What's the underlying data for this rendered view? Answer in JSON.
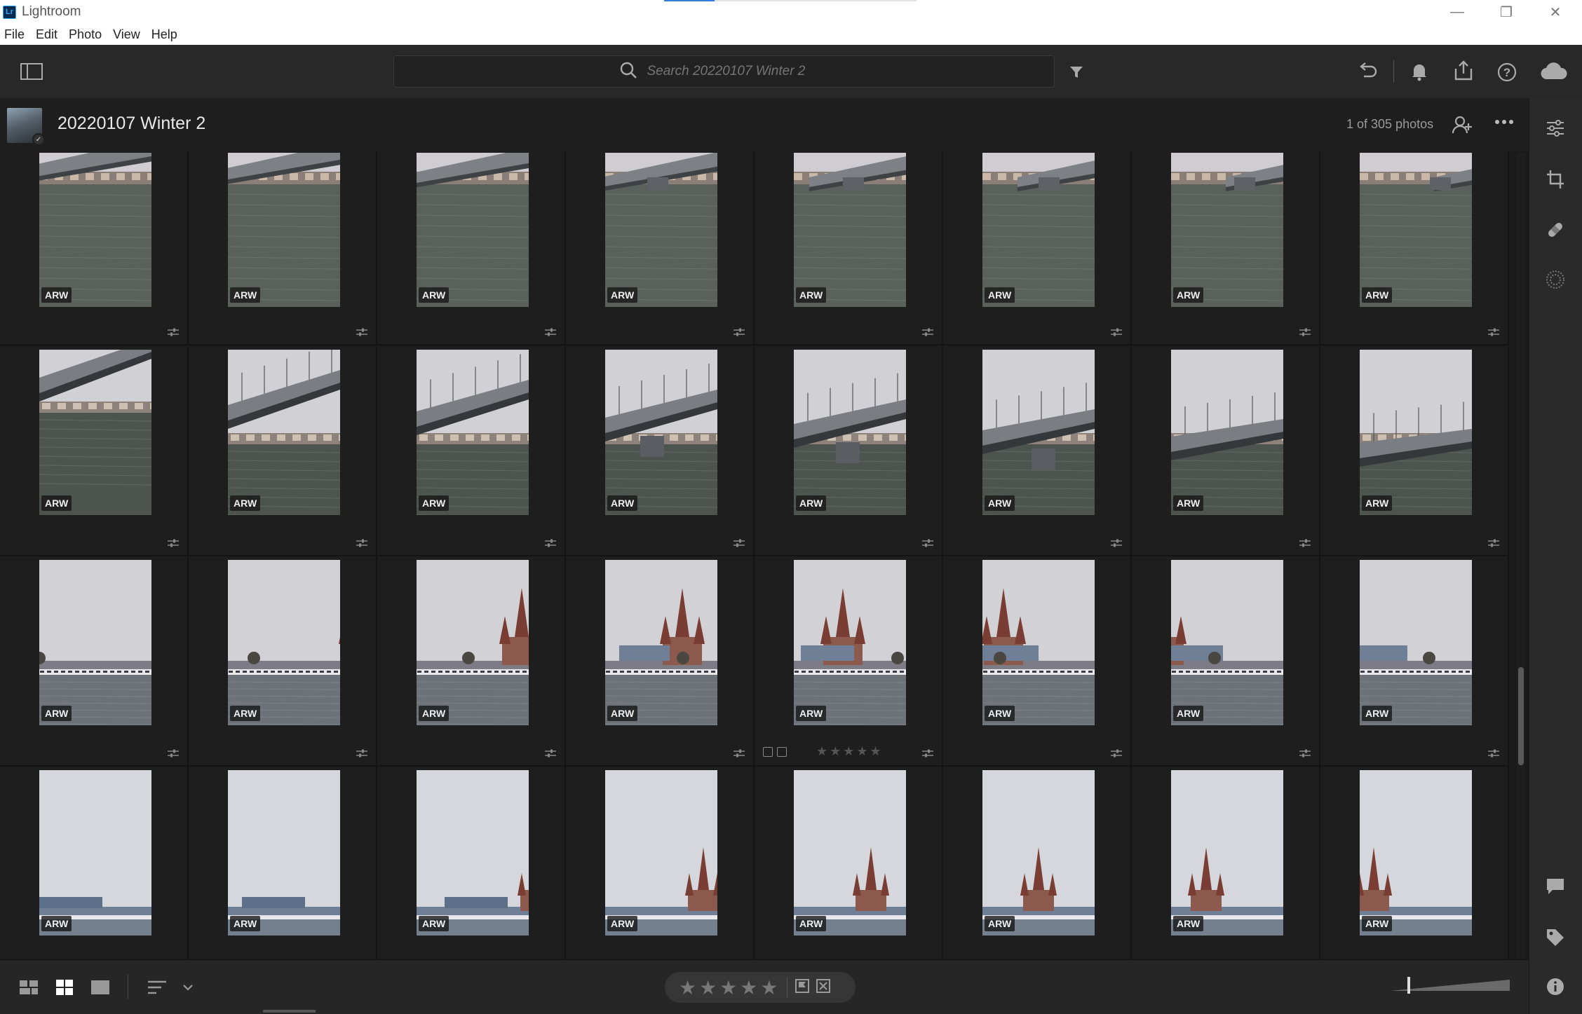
{
  "app": {
    "title": "Lightroom",
    "logo_text": "Lr",
    "sync_progress": 0.2
  },
  "window_controls": {
    "minimize": "—",
    "restore": "❐",
    "close": "✕"
  },
  "menu": [
    "File",
    "Edit",
    "Photo",
    "View",
    "Help"
  ],
  "toolbar": {
    "search_placeholder": "Search 20220107 Winter 2"
  },
  "album": {
    "title": "20220107 Winter 2",
    "count_label": "1 of 305 photos"
  },
  "grid": {
    "columns": 8,
    "file_type_label": "ARW",
    "rows": [
      {
        "scene": "bridge-water",
        "count": 8
      },
      {
        "scene": "bridge-lamps",
        "count": 8
      },
      {
        "scene": "church-river",
        "count": 8
      },
      {
        "scene": "church-sky",
        "count": 8
      }
    ],
    "selected_cell": {
      "row": 2,
      "col": 4
    }
  },
  "bottom": {
    "stars": "★★★★★",
    "rating_selected": 0
  },
  "colors": {
    "accent": "#2f7fe0",
    "panel": "#282828",
    "background": "#1a1a1a"
  }
}
